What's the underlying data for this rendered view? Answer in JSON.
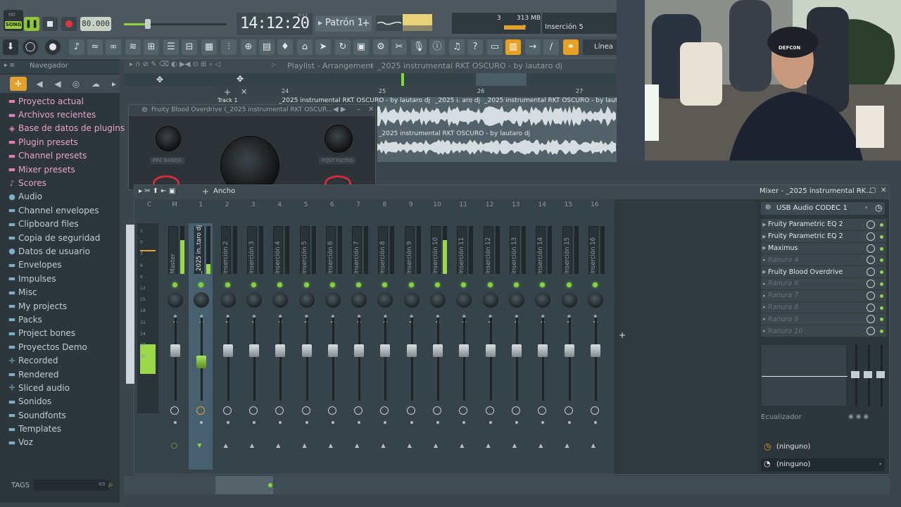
{
  "transport": {
    "pat_label": "PAT",
    "song_label": "SONG",
    "tempo": "80.000",
    "clock": "14:12:20",
    "clock_sub": "B:S:T",
    "pattern": "Patrón 1",
    "cpu_value": "3",
    "ram_value": "313 MB",
    "poly_value": "2",
    "hint": "Inserción 5",
    "snap_label": "Línea"
  },
  "browser": {
    "header": "Navegador",
    "tags_label": "TAGS",
    "items": [
      {
        "label": "Proyecto actual",
        "icon": "folder-icon",
        "pink": true
      },
      {
        "label": "Archivos recientes",
        "icon": "folder-icon",
        "pink": true
      },
      {
        "label": "Base de datos de plugins",
        "icon": "plug-icon",
        "pink": true
      },
      {
        "label": "Plugin presets",
        "icon": "folder-icon",
        "pink": true
      },
      {
        "label": "Channel presets",
        "icon": "folder-icon",
        "pink": true
      },
      {
        "label": "Mixer presets",
        "icon": "folder-icon",
        "pink": true
      },
      {
        "label": "Scores",
        "icon": "note-icon",
        "pink": true
      },
      {
        "label": "Audio",
        "icon": "person-icon",
        "pink": false
      },
      {
        "label": "Channel envelopes",
        "icon": "folder-icon",
        "pink": false
      },
      {
        "label": "Clipboard files",
        "icon": "folder-icon",
        "pink": false
      },
      {
        "label": "Copia de seguridad",
        "icon": "folder-icon",
        "pink": false
      },
      {
        "label": "Datos de usuario",
        "icon": "person-icon",
        "pink": false
      },
      {
        "label": "Envelopes",
        "icon": "folder-icon",
        "pink": false
      },
      {
        "label": "Impulses",
        "icon": "folder-icon",
        "pink": false
      },
      {
        "label": "Misc",
        "icon": "folder-icon",
        "pink": false
      },
      {
        "label": "My projects",
        "icon": "folder-icon",
        "pink": false
      },
      {
        "label": "Packs",
        "icon": "folder-icon",
        "pink": false
      },
      {
        "label": "Project bones",
        "icon": "folder-icon",
        "pink": false
      },
      {
        "label": "Proyectos Demo",
        "icon": "folder-icon",
        "pink": false
      },
      {
        "label": "Recorded",
        "icon": "plus-icon",
        "pink": false
      },
      {
        "label": "Rendered",
        "icon": "folder-icon",
        "pink": false
      },
      {
        "label": "Sliced audio",
        "icon": "plus-icon",
        "pink": false
      },
      {
        "label": "Sonidos",
        "icon": "folder-icon",
        "pink": false
      },
      {
        "label": "Soundfonts",
        "icon": "folder-icon",
        "pink": false
      },
      {
        "label": "Templates",
        "icon": "folder-icon",
        "pink": false
      },
      {
        "label": "Voz",
        "icon": "folder-icon",
        "pink": false
      }
    ]
  },
  "playlist": {
    "title_prefix": "Playlist - Arrangement",
    "title_sep": "›",
    "project": "_2025 instrumental RKT OSCURO - by lautaro dj",
    "track_label": "Track 1",
    "bar_24": "24",
    "bar_25": "25",
    "bar_26": "26",
    "bar_27": "27",
    "clip1": "_2025 instrumental RKT OSCURO - by lautaro dj",
    "clip2": "_2025 i. aro dj",
    "clip3": "_2025 instrumental RKT OSCURO - by lautaro dj",
    "clip4": "_2025 instrumental RKT OSCURO - by lautaro dj"
  },
  "plugin": {
    "title": "Fruity Blood Overdrive (_2025 instrumental RKT OSCUR...",
    "pre_band": "PRE BANDA",
    "post_filter": "POST FILTRO"
  },
  "mixer": {
    "wide_label": "Ancho",
    "title": "Mixer - _2025 instrumental RK...",
    "device": "USB Audio CODEC  1",
    "plus": "+",
    "strips": [
      {
        "num": "C",
        "name": "",
        "level": 0,
        "active": false
      },
      {
        "num": "M",
        "name": "Master",
        "level": 0.7,
        "active": true
      },
      {
        "num": "1",
        "name": "_2025 in..taro dj",
        "level": 0.2,
        "active": true
      },
      {
        "num": "2",
        "name": "Inserción 2",
        "level": 0,
        "active": false
      },
      {
        "num": "3",
        "name": "Inserción 3",
        "level": 0,
        "active": false
      },
      {
        "num": "4",
        "name": "Inserción 4",
        "level": 0,
        "active": false
      },
      {
        "num": "5",
        "name": "Inserción 5",
        "level": 0,
        "active": false
      },
      {
        "num": "6",
        "name": "Inserción 6",
        "level": 0,
        "active": false
      },
      {
        "num": "7",
        "name": "Inserción 7",
        "level": 0,
        "active": false
      },
      {
        "num": "8",
        "name": "Inserción 8",
        "level": 0,
        "active": false
      },
      {
        "num": "9",
        "name": "Inserción 9",
        "level": 0,
        "active": false
      },
      {
        "num": "10",
        "name": "Inserción 10",
        "level": 0.7,
        "active": true
      },
      {
        "num": "11",
        "name": "Inserción 11",
        "level": 0,
        "active": false
      },
      {
        "num": "12",
        "name": "Inserción 12",
        "level": 0,
        "active": false
      },
      {
        "num": "13",
        "name": "Inserción 13",
        "level": 0,
        "active": false
      },
      {
        "num": "14",
        "name": "Inserción 14",
        "level": 0,
        "active": false
      },
      {
        "num": "15",
        "name": "Inserción 15",
        "level": 0,
        "active": false
      },
      {
        "num": "16",
        "name": "Inserción 16",
        "level": 0,
        "active": false
      }
    ],
    "db_ticks": [
      "3",
      "0",
      "3",
      "6",
      "9",
      "12",
      "15",
      "18",
      "21",
      "24",
      "27",
      "30"
    ],
    "slots": [
      {
        "label": "Fruity Parametric EQ 2",
        "empty": false
      },
      {
        "label": "Fruity Parametric EQ 2",
        "empty": false
      },
      {
        "label": "Maximus",
        "empty": false
      },
      {
        "label": "Ranura 4",
        "empty": true
      },
      {
        "label": "Fruity Blood Overdrive",
        "empty": false
      },
      {
        "label": "Ranura 6",
        "empty": true
      },
      {
        "label": "Ranura 7",
        "empty": true
      },
      {
        "label": "Ranura 8",
        "empty": true
      },
      {
        "label": "Ranura 9",
        "empty": true
      },
      {
        "label": "Ranura 10",
        "empty": true
      }
    ],
    "eq_label": "Ecualizador",
    "out1": "(ninguno)",
    "out2": "(ninguno)"
  },
  "webcam": {
    "cap_text": "DEFC0N"
  }
}
